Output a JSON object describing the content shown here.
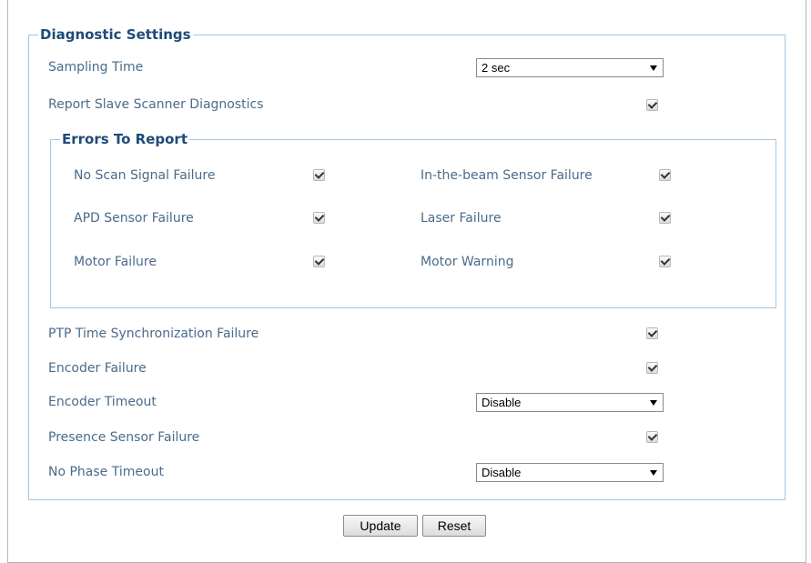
{
  "diagnostic_settings": {
    "legend": "Diagnostic Settings",
    "sampling_time": {
      "label": "Sampling Time",
      "value": "2 sec"
    },
    "report_slave": {
      "label": "Report Slave Scanner Diagnostics",
      "checked": true
    }
  },
  "errors_to_report": {
    "legend": "Errors To Report",
    "items": [
      {
        "label": "No Scan Signal Failure",
        "checked": true
      },
      {
        "label": "In-the-beam Sensor Failure",
        "checked": true
      },
      {
        "label": "APD Sensor Failure",
        "checked": true
      },
      {
        "label": "Laser Failure",
        "checked": true
      },
      {
        "label": "Motor Failure",
        "checked": true
      },
      {
        "label": "Motor Warning",
        "checked": true
      }
    ]
  },
  "ptp_failure": {
    "label": "PTP Time Synchronization Failure",
    "checked": true
  },
  "encoder_failure": {
    "label": "Encoder Failure",
    "checked": true
  },
  "encoder_timeout": {
    "label": "Encoder Timeout",
    "value": "Disable"
  },
  "presence_sensor_failure": {
    "label": "Presence Sensor Failure",
    "checked": true
  },
  "no_phase_timeout": {
    "label": "No Phase Timeout",
    "value": "Disable"
  },
  "buttons": {
    "update": "Update",
    "reset": "Reset"
  }
}
